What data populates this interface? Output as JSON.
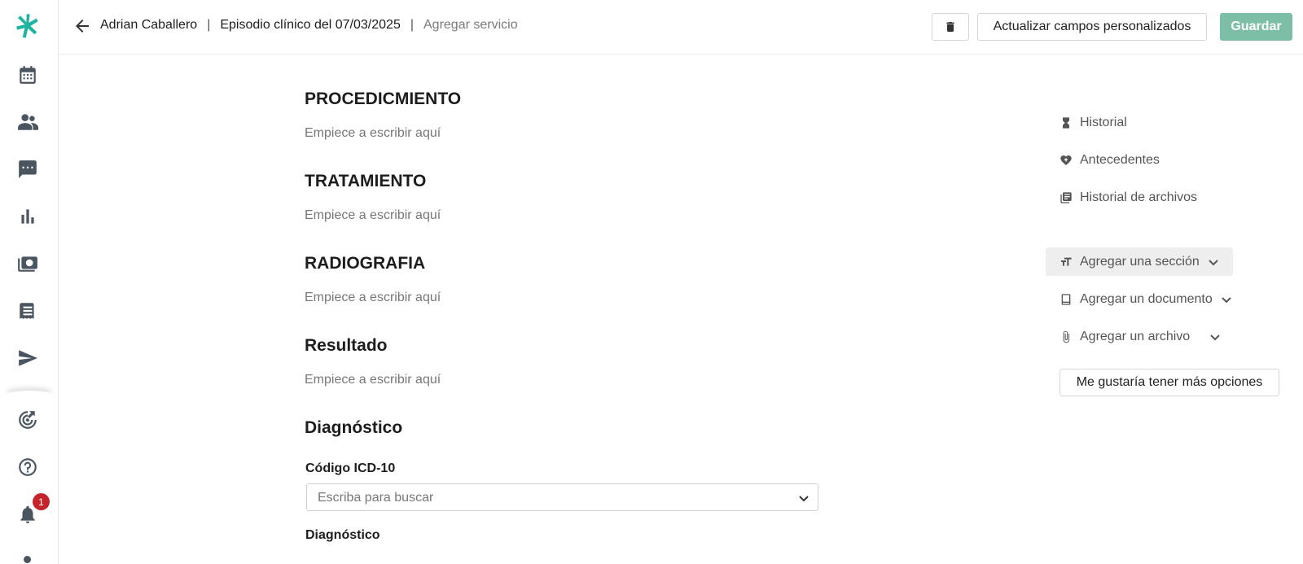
{
  "header": {
    "patient_name": "Adrian Caballero",
    "separator": "|",
    "episode": "Episodio clínico del 07/03/2025",
    "add_service": "Agregar servicio",
    "update_fields_label": "Actualizar campos personalizados",
    "save_label": "Guardar"
  },
  "sidebar": {
    "notification_count": "1",
    "brand_color": "#1fb3a0",
    "icons": [
      "logo-icon",
      "calendar-icon",
      "patients-icon",
      "chat-icon",
      "reports-icon",
      "billing-icon",
      "records-icon",
      "send-icon",
      "progress-icon",
      "help-icon",
      "bell-icon"
    ]
  },
  "sections": [
    {
      "title": "PROCEDICMIENTO",
      "placeholder": "Empiece a escribir aquí"
    },
    {
      "title": "TRATAMIENTO",
      "placeholder": "Empiece a escribir aquí"
    },
    {
      "title": "RADIOGRAFIA",
      "placeholder": "Empiece a escribir aquí"
    },
    {
      "title": "Resultado",
      "placeholder": "Empiece a escribir aquí"
    }
  ],
  "diagnosis": {
    "title": "Diagnóstico",
    "icd_label": "Código ICD-10",
    "icd_placeholder": "Escriba para buscar",
    "diagnosis_label": "Diagnóstico"
  },
  "right_panel": {
    "history": "Historial",
    "background": "Antecedentes",
    "files_history": "Historial de archivos",
    "add_section": "Agregar una sección",
    "add_document": "Agregar un documento",
    "add_file": "Agregar un archivo",
    "more_options": "Me gustaría tener más opciones"
  },
  "colors": {
    "accent": "#7dbfa6",
    "badge": "#c4252c"
  }
}
